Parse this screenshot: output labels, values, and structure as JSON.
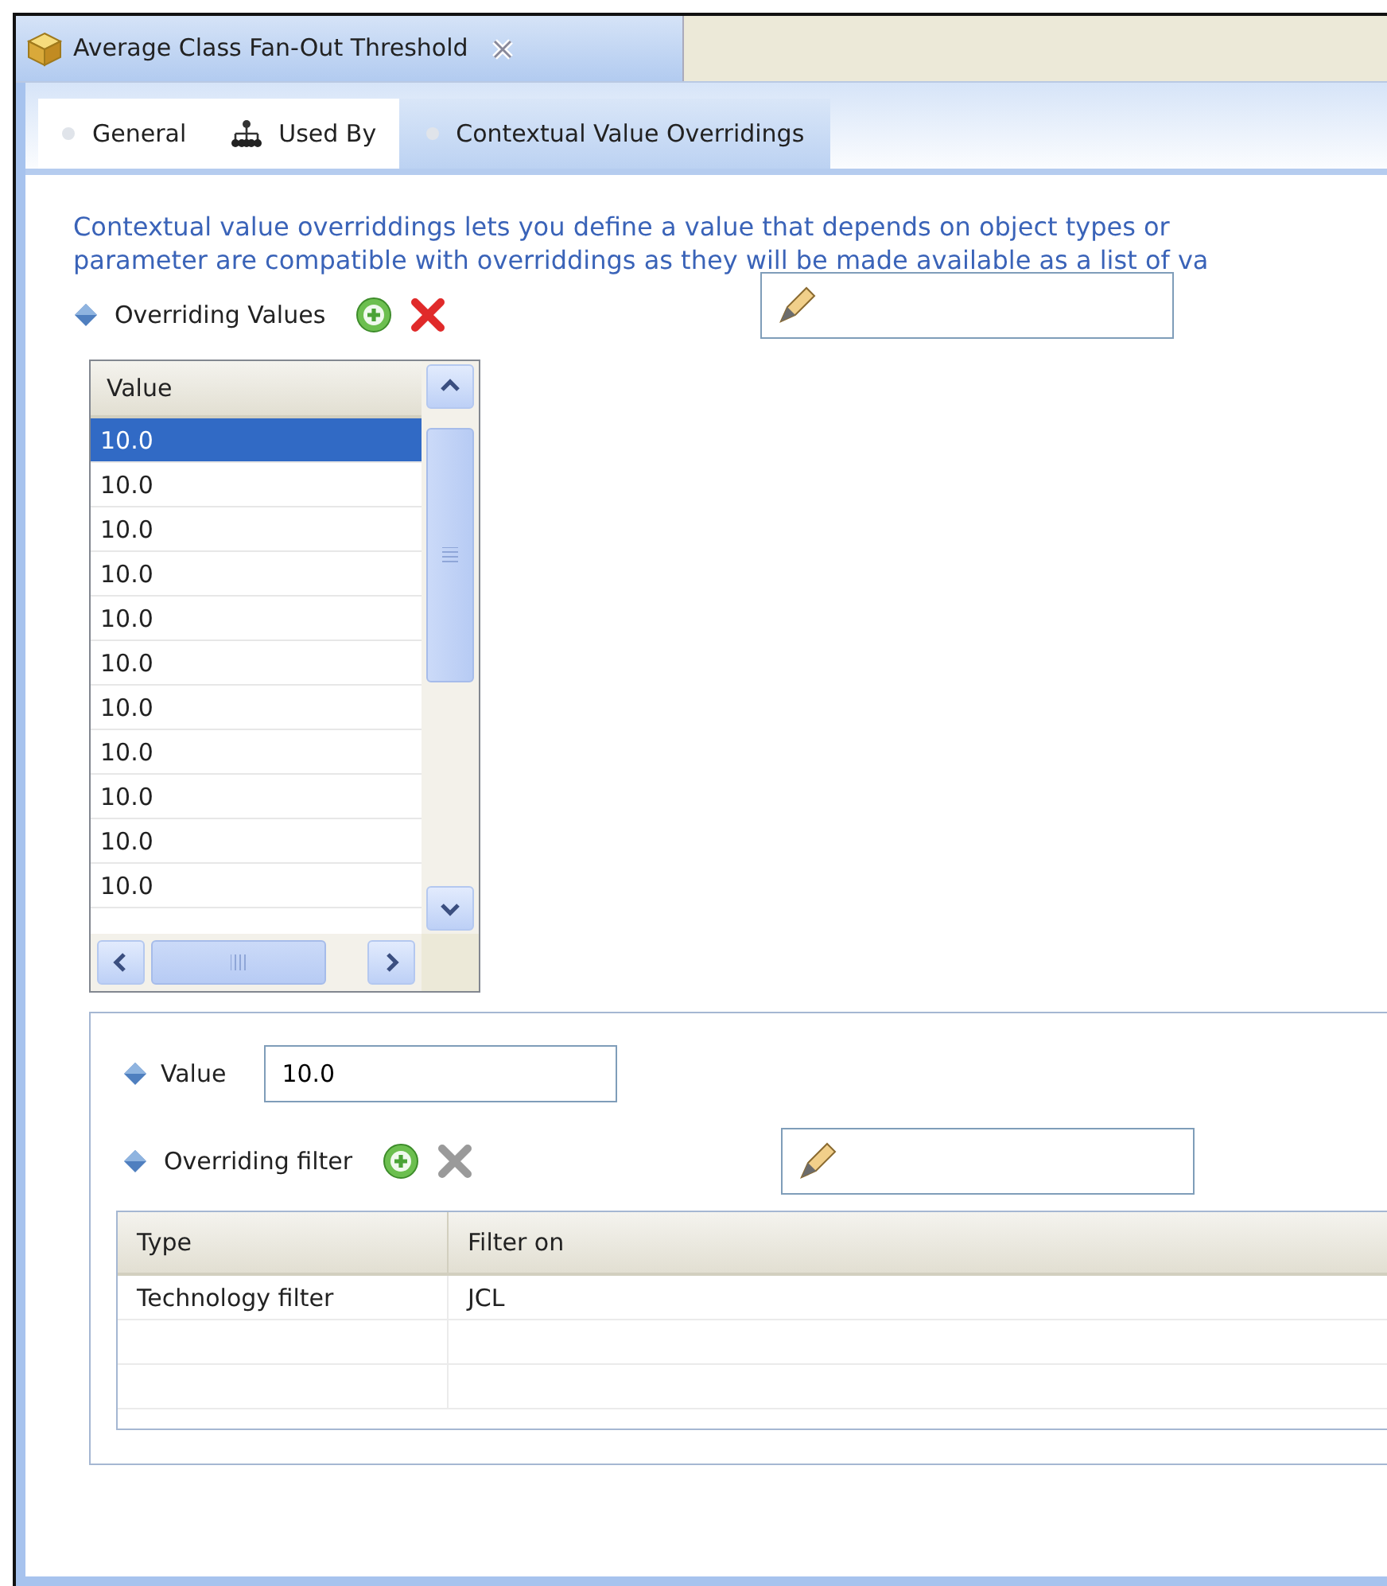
{
  "editor_tab": {
    "title": "Average Class Fan-Out Threshold",
    "selected": true
  },
  "tabs": [
    {
      "label": "General",
      "kind": "dot",
      "selected": false
    },
    {
      "label": "Used By",
      "kind": "tree",
      "selected": false
    },
    {
      "label": "Contextual Value Overridings",
      "kind": "dot",
      "selected": true
    }
  ],
  "description": [
    "Contextual value overriddings lets you define a value that depends on object types or",
    "parameter are compatible with overriddings as they will be made available as a list of va"
  ],
  "overriding_values": {
    "label": "Overriding Values",
    "add_enabled": true,
    "delete_enabled": true,
    "column": "Value",
    "rows": [
      {
        "value": "10.0",
        "selected": true
      },
      {
        "value": "10.0",
        "selected": false
      },
      {
        "value": "10.0",
        "selected": false
      },
      {
        "value": "10.0",
        "selected": false
      },
      {
        "value": "10.0",
        "selected": false
      },
      {
        "value": "10.0",
        "selected": false
      },
      {
        "value": "10.0",
        "selected": false
      },
      {
        "value": "10.0",
        "selected": false
      },
      {
        "value": "10.0",
        "selected": false
      },
      {
        "value": "10.0",
        "selected": false
      },
      {
        "value": "10.0",
        "selected": false
      }
    ]
  },
  "value_field": {
    "label": "Value",
    "value": "10.0"
  },
  "overriding_filter": {
    "label": "Overriding filter",
    "add_enabled": true,
    "delete_enabled": false,
    "columns": [
      "Type",
      "Filter on"
    ],
    "rows": [
      [
        "Technology filter",
        "JCL"
      ]
    ]
  }
}
